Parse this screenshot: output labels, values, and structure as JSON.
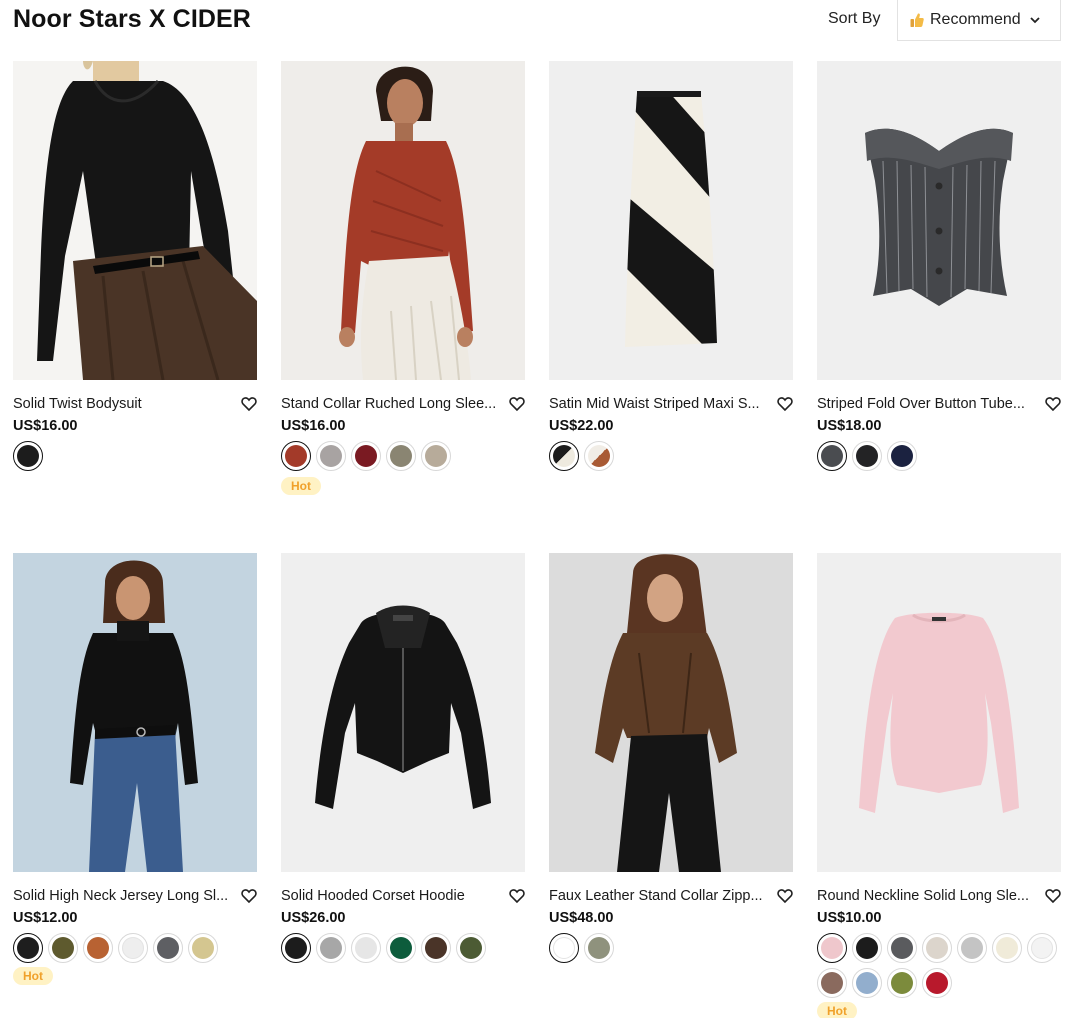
{
  "page": {
    "title": "Noor Stars X CIDER",
    "sort_label": "Sort By",
    "sort_value": "Recommend",
    "sort_icon": "thumbs-up-icon"
  },
  "products": [
    {
      "name": "Solid Twist Bodysuit",
      "price": "US$16.00",
      "hot": false,
      "image": "black twist long-sleeve bodysuit with brown skirt",
      "swatches": [
        "#1c1c1c"
      ]
    },
    {
      "name": "Stand Collar Ruched Long Slee...",
      "price": "US$16.00",
      "hot": true,
      "hot_label": "Hot",
      "image": "rust red ruched top with white skirt",
      "swatches": [
        "#a33a29",
        "#a8a3a2",
        "#7a1a22",
        "#8a8572",
        "#b7ab9a"
      ]
    },
    {
      "name": "Satin Mid Waist Striped Maxi S...",
      "price": "US$22.00",
      "hot": false,
      "image": "black and cream diagonal striped maxi skirt",
      "swatches": [
        "split:#1c1c1c:#eeeadf",
        "split:#f1ede6:#a85a34"
      ]
    },
    {
      "name": "Striped Fold Over Button Tube...",
      "price": "US$18.00",
      "hot": false,
      "image": "grey pinstripe fold-over button tube top",
      "swatches": [
        "#4a4c50",
        "#232325",
        "#1b2240"
      ]
    },
    {
      "name": "Solid High Neck Jersey Long Sl...",
      "price": "US$12.00",
      "hot": true,
      "hot_label": "Hot",
      "image": "black high neck jersey top with blue jeans",
      "swatches": [
        "#1e1e1e",
        "#5e5a2e",
        "#b86232",
        "#eeeeee",
        "#5e5f63",
        "#d4c690"
      ]
    },
    {
      "name": "Solid Hooded Corset Hoodie",
      "price": "US$26.00",
      "hot": false,
      "image": "black hooded corset zip hoodie",
      "swatches": [
        "#1c1c1c",
        "#a7a7a7",
        "#e6e6e6",
        "#0d5c3c",
        "#4a3428",
        "#4c5b34"
      ]
    },
    {
      "name": "Faux Leather Stand Collar Zipp...",
      "price": "US$48.00",
      "hot": false,
      "image": "brown faux leather stand collar jacket",
      "swatches": [
        "#ffffff",
        "#8f927d"
      ]
    },
    {
      "name": "Round Neckline Solid Long Sle...",
      "price": "US$10.00",
      "hot": true,
      "hot_label": "Hot",
      "image": "pink round neckline long sleeve top",
      "swatches": [
        "#efc7cc",
        "#1c1c1c",
        "#5a5b5e",
        "#dcd5cc",
        "#c4c4c4",
        "#f0ebd9",
        "#f3f3f3",
        "#8a6a5e",
        "#92aecd",
        "#7c8b3c",
        "#b8192c"
      ]
    }
  ],
  "icons": {
    "wishlist": "heart-icon",
    "sort_chevron": "chevron-down-icon"
  }
}
